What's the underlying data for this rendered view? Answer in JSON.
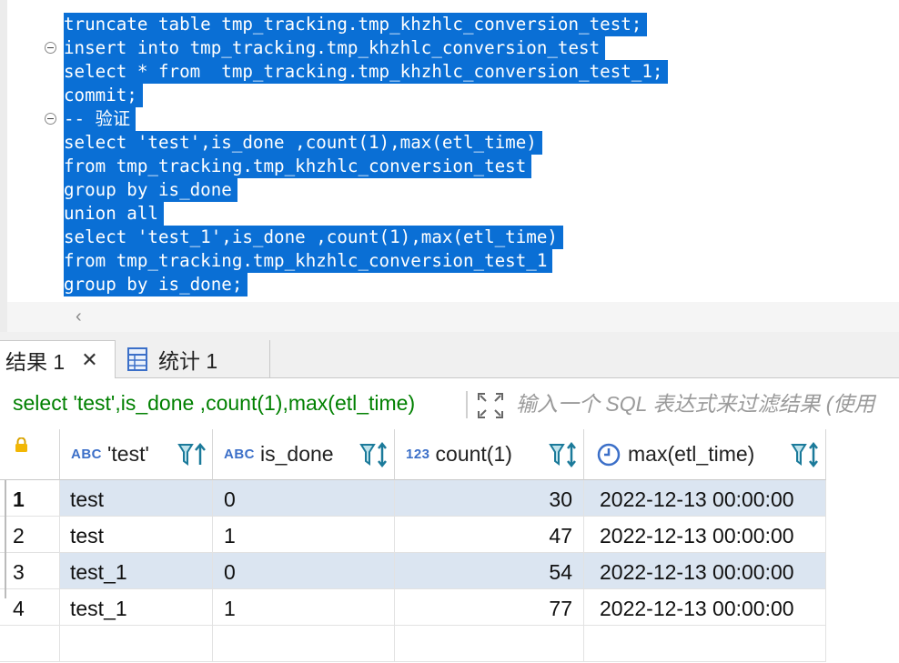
{
  "editor": {
    "lines": [
      "truncate table tmp_tracking.tmp_khzhlc_conversion_test;",
      "insert into tmp_tracking.tmp_khzhlc_conversion_test",
      "select * from  tmp_tracking.tmp_khzhlc_conversion_test_1;",
      "commit;",
      "-- 验证",
      "select 'test',is_done ,count(1),max(etl_time)",
      "from tmp_tracking.tmp_khzhlc_conversion_test",
      "group by is_done",
      "union all",
      "select 'test_1',is_done ,count(1),max(etl_time)",
      "from tmp_tracking.tmp_khzhlc_conversion_test_1",
      "group by is_done;"
    ],
    "selection_color": "#0a6fd5"
  },
  "tabs": [
    {
      "label": "结果 1",
      "icon": "close-icon"
    },
    {
      "label": "统计 1",
      "icon": "statistics-icon"
    }
  ],
  "filter": {
    "query": "select 'test',is_done ,count(1),max(etl_time)",
    "placeholder": "输入一个 SQL 表达式来过滤结果 (使用"
  },
  "grid": {
    "columns": [
      {
        "type": "ABC",
        "name": "'test'"
      },
      {
        "type": "ABC",
        "name": "is_done"
      },
      {
        "type": "123",
        "name": "count(1)"
      },
      {
        "type": "clock",
        "name": "max(etl_time)"
      }
    ],
    "rows": [
      {
        "num": "1",
        "cells": [
          "test",
          "0",
          "30",
          "2022-12-13 00:00:00"
        ]
      },
      {
        "num": "2",
        "cells": [
          "test",
          "1",
          "47",
          "2022-12-13 00:00:00"
        ]
      },
      {
        "num": "3",
        "cells": [
          "test_1",
          "0",
          "54",
          "2022-12-13 00:00:00"
        ]
      },
      {
        "num": "4",
        "cells": [
          "test_1",
          "1",
          "77",
          "2022-12-13 00:00:00"
        ]
      }
    ]
  }
}
